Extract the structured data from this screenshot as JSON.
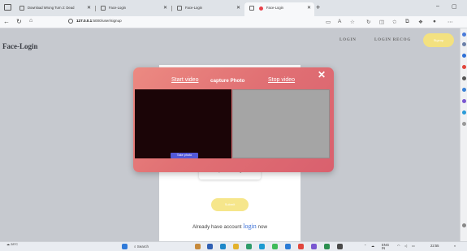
{
  "browser": {
    "tabs": [
      {
        "label": "Download Wrong Turn 2: Dead",
        "active": false
      },
      {
        "label": "Face-Login",
        "active": false
      },
      {
        "label": "Face-Login",
        "active": false
      },
      {
        "label": "Face-Login",
        "active": true,
        "recording": true
      }
    ],
    "new_tab": "+",
    "window_controls": {
      "minimize": "–",
      "maximize": "▢"
    },
    "address": {
      "host": "127.0.0.1",
      "rest": ":5000/user/signup"
    }
  },
  "site": {
    "brand": "Face-Login",
    "nav": {
      "login": "LOGIN",
      "login_recog": "LOGIN RECOG",
      "pill": "Signup"
    }
  },
  "form": {
    "capture_images": "Capture Images",
    "submit": "Submit",
    "already_prefix": "Already have account",
    "login_link": "login",
    "already_suffix": "now"
  },
  "modal": {
    "start_video": "Start video",
    "title": "capture Photo",
    "stop_video": "Stop video",
    "close": "✕",
    "take_photo": "Take photo"
  },
  "taskbar": {
    "temperature": "28°C",
    "search": "Search",
    "lang_top": "ENG",
    "lang_bottom": "IN",
    "time": "22:55"
  },
  "colors": {
    "modal_gradient_start": "#ec8a82",
    "modal_gradient_end": "#d9606e",
    "accent_yellow": "#f3e180",
    "take_photo_blue": "#5259d8",
    "link_blue": "#3a6fd8"
  }
}
